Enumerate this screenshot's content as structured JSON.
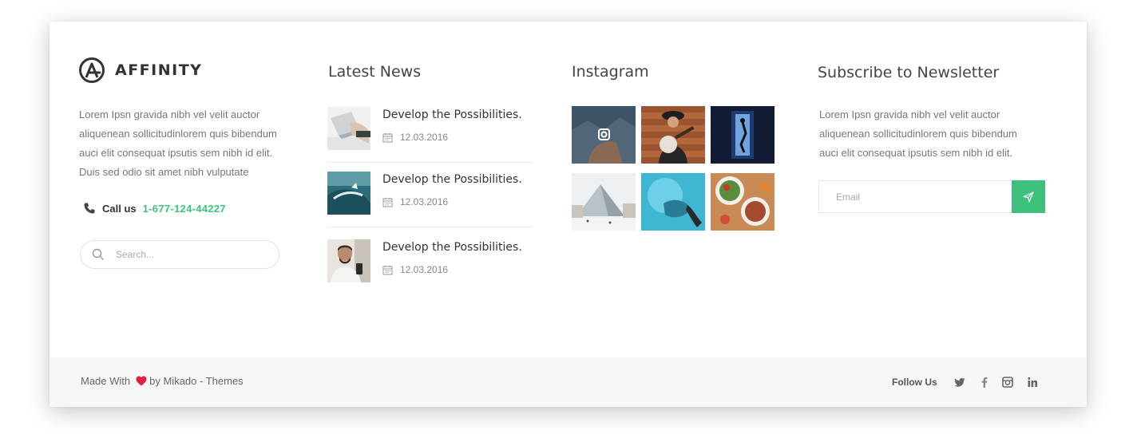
{
  "brand": {
    "name": "AFFINITY",
    "description": "Lorem Ipsn gravida nibh vel velit auctor aliquenean sollicitudinlorem quis bibendum auci elit consequat ipsutis sem nibh id elit. Duis sed odio sit amet nibh vulputate",
    "call_label": "Call us",
    "phone": "1-677-124-44227",
    "search_placeholder": "Search..."
  },
  "news": {
    "heading": "Latest News",
    "items": [
      {
        "title": "Develop the Possibilities.",
        "date": "12.03.2016"
      },
      {
        "title": "Develop the Possibilities.",
        "date": "12.03.2016"
      },
      {
        "title": "Develop the Possibilities.",
        "date": "12.03.2016"
      }
    ]
  },
  "instagram": {
    "heading": "Instagram"
  },
  "newsletter": {
    "heading": "Subscribe to Newsletter",
    "description": "Lorem Ipsn gravida nibh vel velit auctor aliquenean sollicitudinlorem quis bibendum auci elit consequat ipsutis sem nibh id elit.",
    "email_placeholder": "Email"
  },
  "footer": {
    "made_prefix": "Made With",
    "made_suffix": "by Mikado - Themes",
    "follow_label": "Follow Us",
    "social_icons": [
      "twitter-icon",
      "facebook-icon",
      "instagram-icon",
      "linkedin-icon"
    ]
  },
  "colors": {
    "accent": "#3ec07d",
    "heart": "#e0223f"
  }
}
